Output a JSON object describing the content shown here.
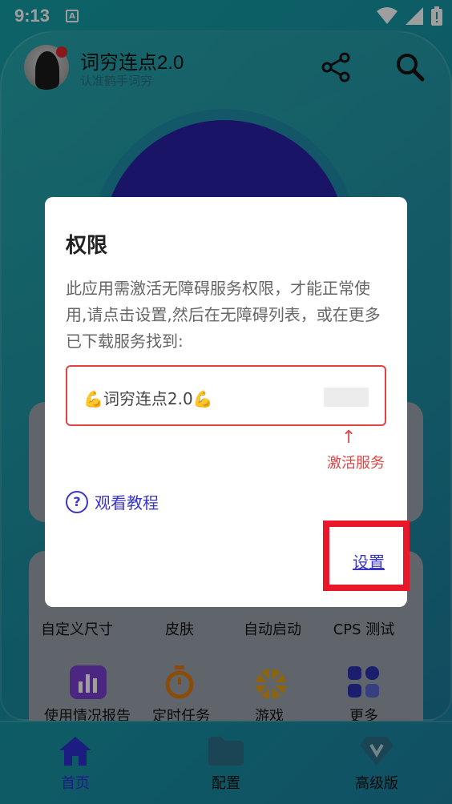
{
  "status_bar": {
    "time": "9:13",
    "notif_glyph": "A"
  },
  "header": {
    "title": "词穷连点2.0",
    "subtitle": "认准鹤手词穷"
  },
  "grid": {
    "row1": [
      "自定义尺寸",
      "皮肤",
      "自动启动",
      "CPS 测试"
    ],
    "row2": [
      "使用情况报告",
      "定时任务",
      "游戏",
      "更多"
    ]
  },
  "bottom_nav": {
    "items": [
      {
        "label": "首页",
        "icon": "home-icon",
        "active": true
      },
      {
        "label": "配置",
        "icon": "folder-icon",
        "active": false
      },
      {
        "label": "高级版",
        "icon": "diamond-icon",
        "active": false
      }
    ]
  },
  "dialog": {
    "title": "权限",
    "body": "此应用需激活无障碍服务权限，才能正常使用,请点击设置,然后在无障碍列表，或在更多已下载服务找到:",
    "service_name": "💪词穷连点2.0💪",
    "arrow": "↑",
    "activate_hint": "激活服务",
    "tutorial_label": "观看教程",
    "settings_label": "设置"
  },
  "colors": {
    "accent": "#3a36c8",
    "highlight_red": "#e8172a",
    "background": "#14a0a5"
  }
}
